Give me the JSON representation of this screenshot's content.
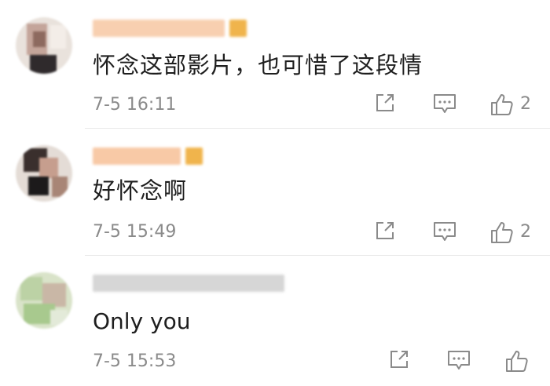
{
  "comments": [
    {
      "text": "怀念这部影片，也可惜了这段情",
      "time": "7-5 16:11",
      "likes": "2",
      "share_icon": "share-icon",
      "reply_icon": "comment-icon",
      "like_icon": "thumbs-up-icon"
    },
    {
      "text": "好怀念啊",
      "time": "7-5 15:49",
      "likes": "2",
      "share_icon": "share-icon",
      "reply_icon": "comment-icon",
      "like_icon": "thumbs-up-icon"
    },
    {
      "text": "Only you",
      "time": "7-5 15:53",
      "likes": "",
      "share_icon": "share-icon",
      "reply_icon": "comment-icon",
      "like_icon": "thumbs-up-icon"
    }
  ],
  "colors": {
    "text": "#1e1e1e",
    "meta": "#8a8a8a",
    "divider": "#e8e8e8",
    "username_blur": "#f7c9a6",
    "badge": "#f0b44c"
  }
}
